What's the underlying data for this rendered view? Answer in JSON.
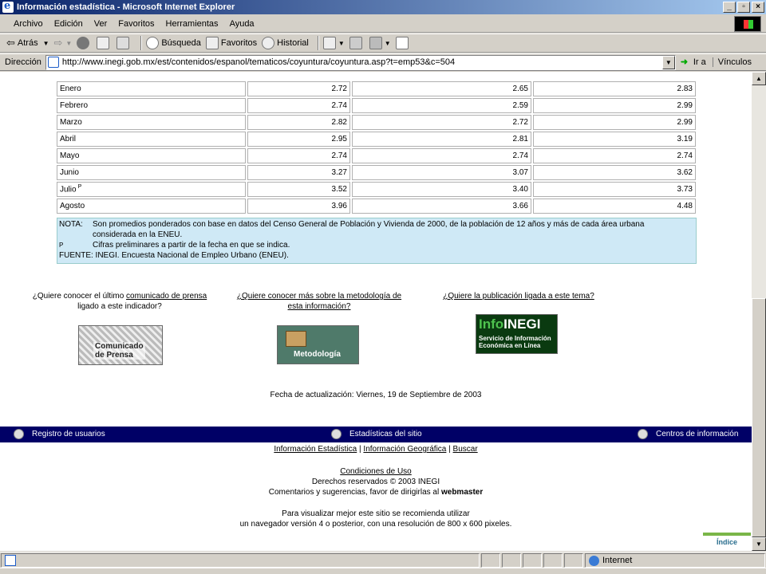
{
  "window": {
    "title": "Información estadística - Microsoft Internet Explorer",
    "buttons": [
      "_",
      "▫",
      "×"
    ]
  },
  "menu": [
    "Archivo",
    "Edición",
    "Ver",
    "Favoritos",
    "Herramientas",
    "Ayuda"
  ],
  "toolbar": {
    "back": "Atrás",
    "search": "Búsqueda",
    "favorites": "Favoritos",
    "history": "Historial"
  },
  "address": {
    "label": "Dirección",
    "url": "http://www.inegi.gob.mx/est/contenidos/espanol/tematicos/coyuntura/coyuntura.asp?t=emp53&c=504",
    "go": "Ir a",
    "links": "Vínculos"
  },
  "table": {
    "rows": [
      {
        "month": "Enero",
        "v1": "2.72",
        "v2": "2.65",
        "v3": "2.83"
      },
      {
        "month": "Febrero",
        "v1": "2.74",
        "v2": "2.59",
        "v3": "2.99"
      },
      {
        "month": "Marzo",
        "v1": "2.82",
        "v2": "2.72",
        "v3": "2.99"
      },
      {
        "month": "Abril",
        "v1": "2.95",
        "v2": "2.81",
        "v3": "3.19"
      },
      {
        "month": "Mayo",
        "v1": "2.74",
        "v2": "2.74",
        "v3": "2.74"
      },
      {
        "month": "Junio",
        "v1": "3.27",
        "v2": "3.07",
        "v3": "3.62"
      },
      {
        "month": "Julio",
        "mark": "P",
        "v1": "3.52",
        "v2": "3.40",
        "v3": "3.73"
      },
      {
        "month": "Agosto",
        "v1": "3.96",
        "v2": "3.66",
        "v3": "4.48"
      }
    ]
  },
  "notes": {
    "nota_key": "NOTA:",
    "nota_text": "Son promedios ponderados con base en datos del Censo General de Población y Vivienda de 2000, de la población de 12 años y más de cada área urbana",
    "nota_text2": "considerada en la ENEU.",
    "p_key": "P",
    "p_text": "Cifras preliminares a partir de la fecha en que se indica.",
    "fuente": "FUENTE: INEGI. Encuesta Nacional de Empleo Urbano (ENEU)."
  },
  "questions": {
    "q1_pre": "¿Quiere conocer el último ",
    "q1_link": "comunicado de prensa",
    "q1_post": "ligado a este indicador?",
    "q2_line1": "¿Quiere conocer más sobre la metodología de",
    "q2_line2": "esta información?",
    "q3": "¿Quiere la publicación ligada a este tema?"
  },
  "logos": {
    "press_l1": "Comunicado",
    "press_l2": "de Prensa",
    "met": "Metodología",
    "info_a": "Info",
    "info_b": "INEGI",
    "info_sub1": "Servicio de Información",
    "info_sub2": "Económica en Línea"
  },
  "updated": "Fecha de actualización: Viernes, 19 de Septiembre de 2003",
  "navbar": {
    "registro": "Registro de usuarios",
    "estadisticas": "Estadísticas del sitio",
    "centros": "Centros de información"
  },
  "footer": {
    "link1": "Información Estadística",
    "link2": "Información Geográfica",
    "link3": "Buscar",
    "sep": "|",
    "condiciones": "Condiciones de Uso",
    "derechos": "Derechos reservados © 2003 INEGI",
    "comentarios": "Comentarios y sugerencias, favor de dirigirlas al ",
    "webmaster": "webmaster",
    "rec1": "Para visualizar mejor este sitio se recomienda utilizar",
    "rec2": "un navegador versión 4 o posterior, con una resolución de 800 x 600 pixeles.",
    "indice": "Índice"
  },
  "status": {
    "zone": "Internet"
  }
}
